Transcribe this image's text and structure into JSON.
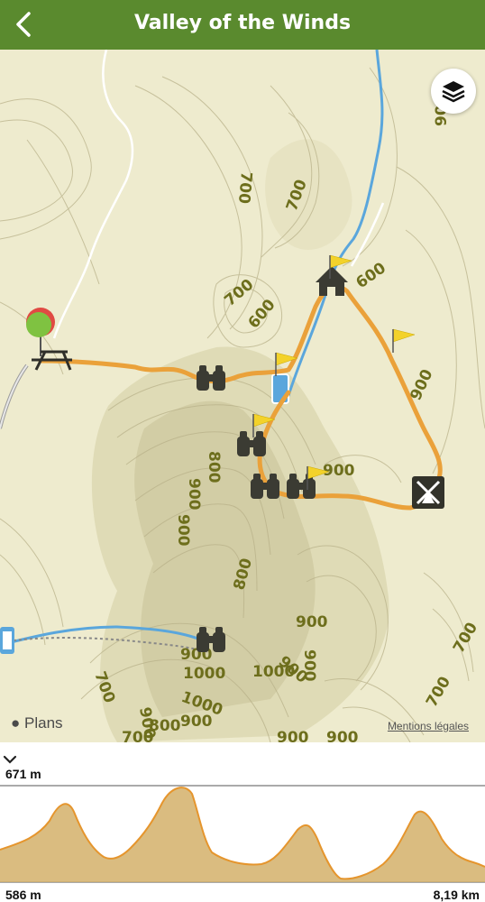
{
  "header": {
    "title": "Valley of the Winds",
    "back_icon": "chevron-left-icon",
    "background": "#5a8a2e"
  },
  "map": {
    "attribution": "Plans",
    "legal_link": "Mentions légales",
    "layers_icon": "layers-icon",
    "contour_labels": [
      "900",
      "700",
      "700",
      "700",
      "600",
      "900",
      "600",
      "800",
      "900",
      "900",
      "800",
      "900",
      "1000",
      "900",
      "1000",
      "1000",
      "900",
      "700",
      "700",
      "800",
      "900",
      "900",
      "700",
      "900",
      "900",
      "800",
      "800",
      "700"
    ],
    "markers": [
      "start-pin-icon",
      "picnic-table-icon",
      "shelter-icon",
      "viewpoint-icon",
      "campsite-icon",
      "waypoint-flag-icon"
    ],
    "route_color": "#eaa13a"
  },
  "profile": {
    "toggle_icon": "chevron-down-icon",
    "max_elevation": "671 m",
    "min_elevation": "586 m",
    "total_distance": "8,19 km"
  }
}
